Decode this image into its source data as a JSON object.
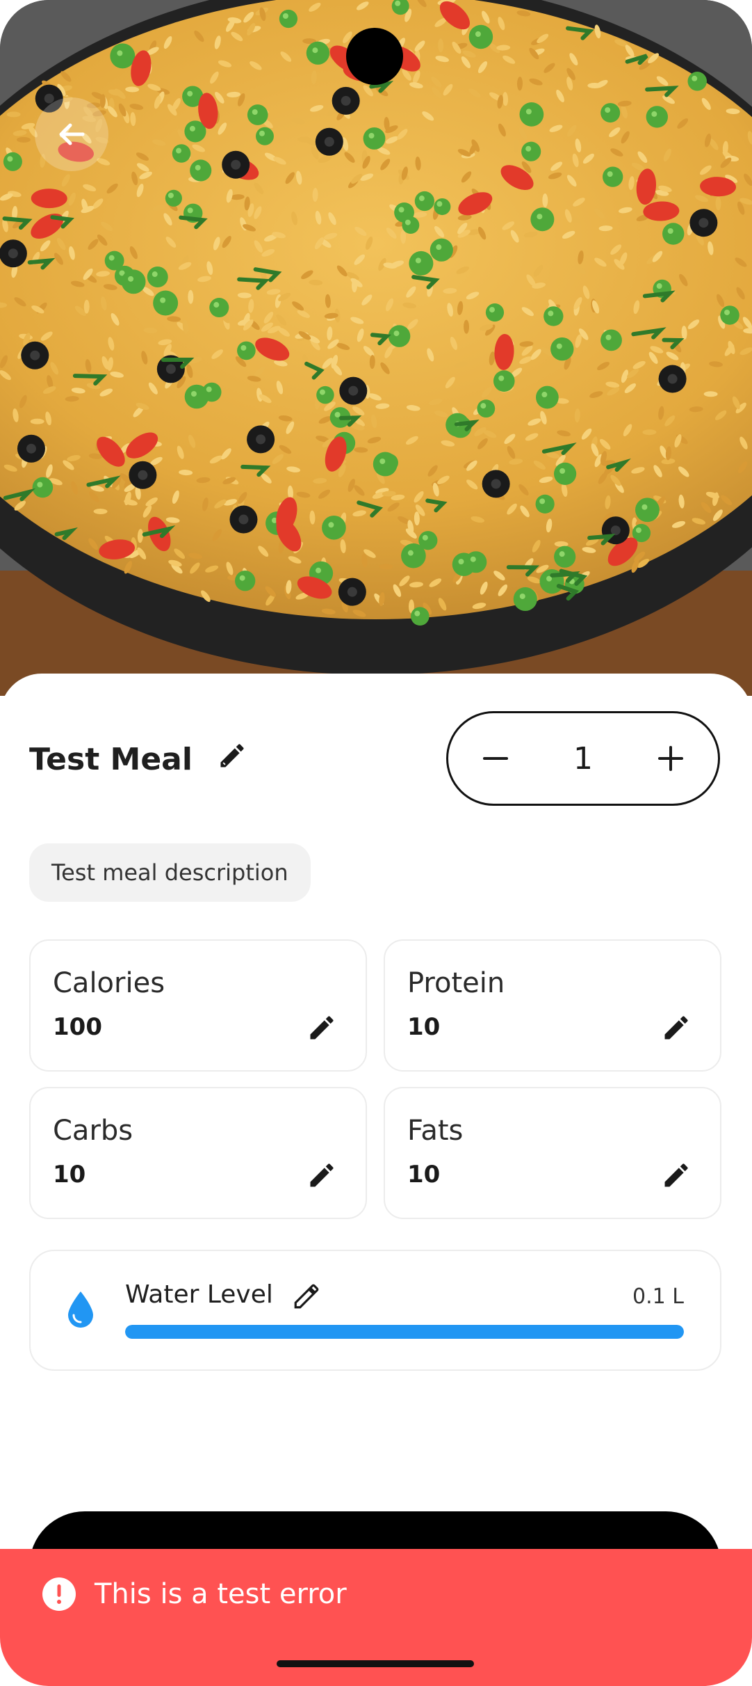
{
  "meal": {
    "title": "Test Meal",
    "quantity": "1",
    "description": "Test meal description"
  },
  "nutrients": [
    {
      "label": "Calories",
      "value": "100"
    },
    {
      "label": "Protein",
      "value": "10"
    },
    {
      "label": "Carbs",
      "value": "10"
    },
    {
      "label": "Fats",
      "value": "10"
    }
  ],
  "water": {
    "label": "Water Level",
    "value": "0.1 L",
    "progress_fraction": 1.0
  },
  "error": {
    "message": "This is a test error"
  },
  "colors": {
    "accent_blue": "#2196f3",
    "error_red": "#ff5252",
    "primary_black": "#000000"
  },
  "icons": {
    "back": "arrow-left-icon",
    "edit": "pencil-icon",
    "minus": "minus-icon",
    "plus": "plus-icon",
    "water": "water-drop-icon",
    "error": "exclamation-circle-icon"
  }
}
